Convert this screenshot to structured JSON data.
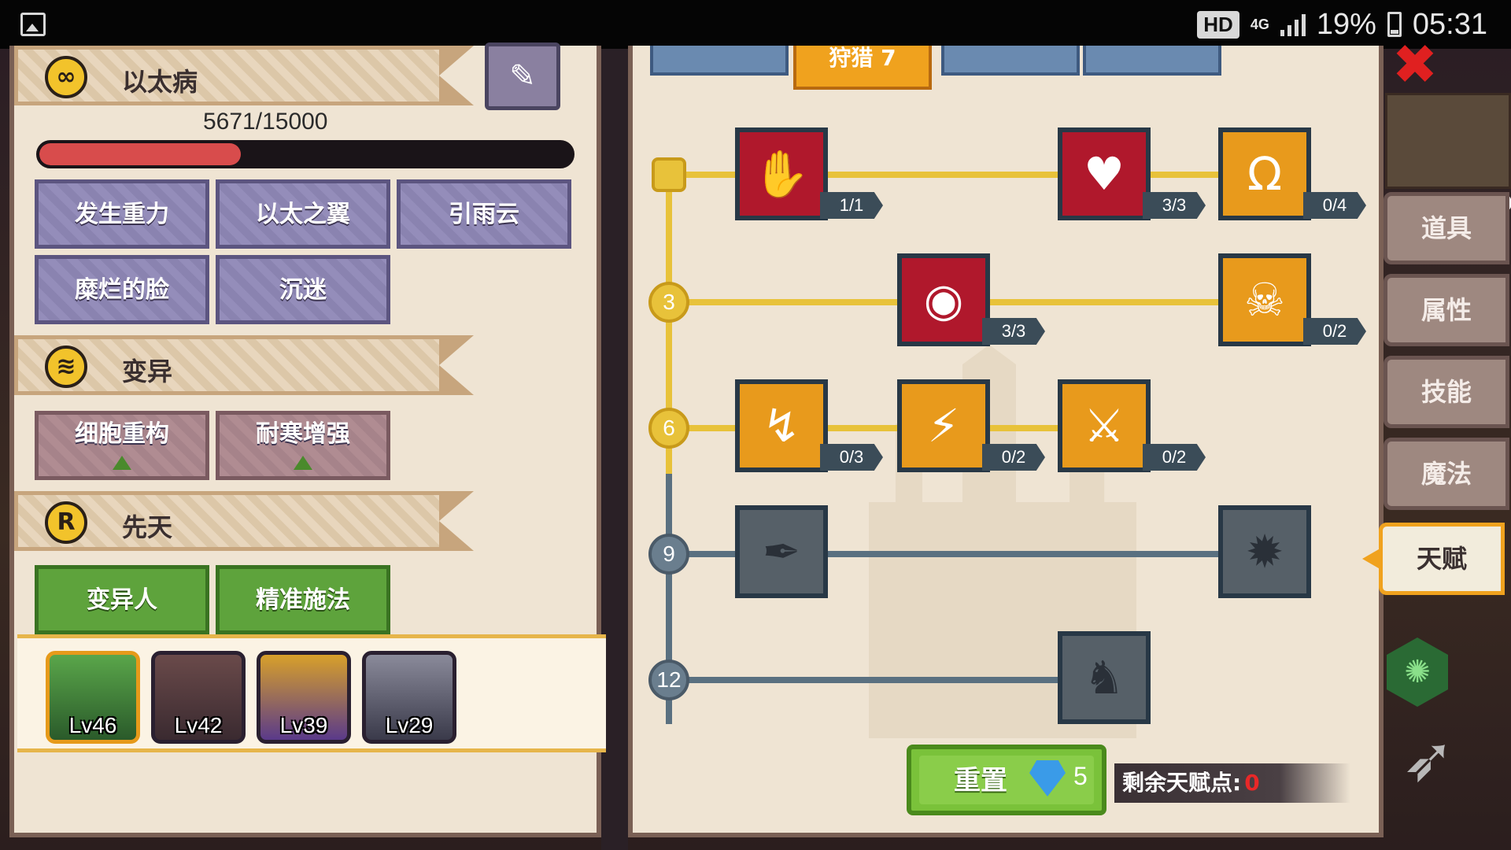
{
  "status_bar": {
    "hd": "HD",
    "network": "4G",
    "battery_pct": "19%",
    "time": "05:31"
  },
  "character": {
    "disease_title": "以太病",
    "hp_text": "5671/15000",
    "hp_fraction": 0.378,
    "disease_skills": [
      "发生重力",
      "以太之翼",
      "引雨云",
      "糜烂的脸",
      "沉迷"
    ],
    "mutation_title": "变异",
    "mutations": [
      "细胞重构",
      "耐寒增强"
    ],
    "innate_title": "先天",
    "innate": [
      "变异人",
      "精准施法"
    ]
  },
  "party": [
    {
      "level": "Lv46",
      "selected": true
    },
    {
      "level": "Lv42",
      "selected": false
    },
    {
      "level": "Lv39",
      "selected": false
    },
    {
      "level": "Lv29",
      "selected": false
    }
  ],
  "talent": {
    "active_tab": "狩猎 7",
    "rows": [
      "3",
      "6",
      "9",
      "12"
    ],
    "skills": [
      {
        "count": "1/1",
        "color": "red",
        "icon": "hand-icon"
      },
      {
        "count": "3/3",
        "color": "red",
        "icon": "muscle-icon"
      },
      {
        "count": "0/4",
        "color": "orange",
        "icon": "horseshoe-icon"
      },
      {
        "count": "3/3",
        "color": "red",
        "icon": "eye-icon"
      },
      {
        "count": "0/2",
        "color": "orange",
        "icon": "skull-shield-icon"
      },
      {
        "count": "0/3",
        "color": "orange",
        "icon": "zigzag-arrow-icon"
      },
      {
        "count": "0/2",
        "color": "orange",
        "icon": "boot-icon"
      },
      {
        "count": "0/2",
        "color": "orange",
        "icon": "crossed-swords-icon"
      },
      {
        "count": "",
        "color": "locked",
        "icon": "syringe-icon"
      },
      {
        "count": "",
        "color": "locked",
        "icon": "skull-gear-icon"
      },
      {
        "count": "",
        "color": "locked",
        "icon": "knight-icon"
      }
    ],
    "reset_label": "重置",
    "reset_cost": "5",
    "remaining_label": "剩余天赋点:",
    "remaining_value": "0"
  },
  "side_tabs": [
    "道具",
    "属性",
    "技能",
    "魔法",
    "天赋"
  ],
  "active_side_tab": "天赋",
  "colors": {
    "accent_gold": "#f0a21e",
    "hp_red": "#d84c4c",
    "skill_red": "#b0182c",
    "skill_orange": "#e89a1c"
  }
}
